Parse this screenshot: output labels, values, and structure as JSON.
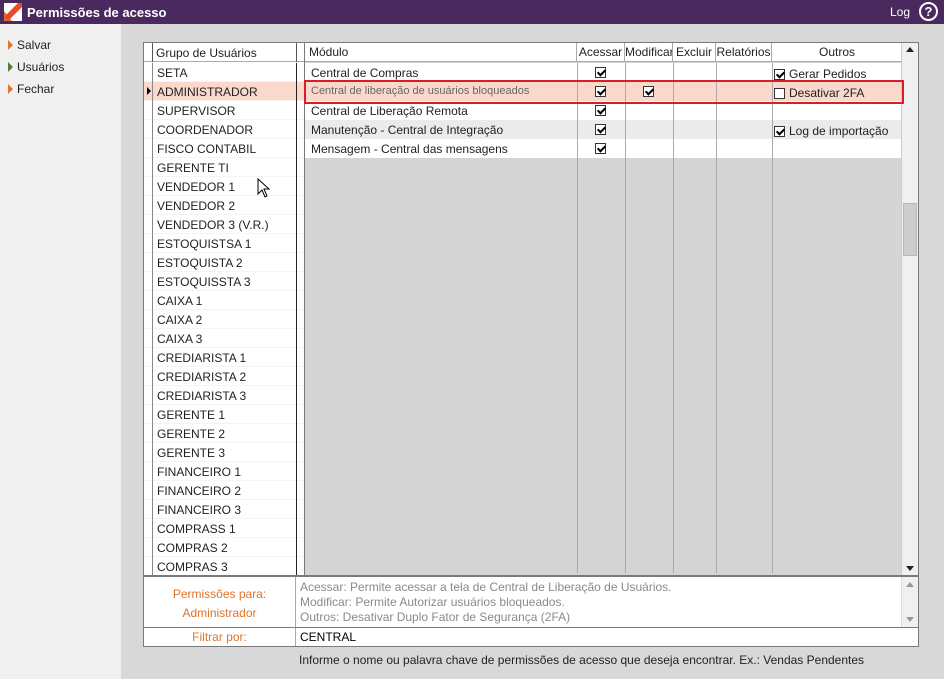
{
  "window": {
    "title": "Permissões de acesso",
    "log_label": "Log",
    "help_label": "?"
  },
  "sidebar": {
    "items": [
      {
        "label": "Salvar",
        "arrow_color": "#e0742a"
      },
      {
        "label": "Usuários",
        "arrow_color": "#5a7a3a"
      },
      {
        "label": "Fechar",
        "arrow_color": "#e0742a"
      }
    ]
  },
  "groups": {
    "header": "Grupo de Usuários",
    "selected_index": 1,
    "items": [
      "SETA",
      "ADMINISTRADOR",
      "SUPERVISOR",
      "COORDENADOR",
      "FISCO CONTABIL",
      "GERENTE TI",
      "VENDEDOR 1",
      "VENDEDOR 2",
      "VENDEDOR 3 (V.R.)",
      "ESTOQUISTSA 1",
      "ESTOQUISTA 2",
      "ESTOQUISSTA 3",
      "CAIXA 1",
      "CAIXA 2",
      "CAIXA 3",
      "CREDIARISTA 1",
      "CREDIARISTA 2",
      "CREDIARISTA 3",
      "GERENTE 1",
      "GERENTE 2",
      "GERENTE 3",
      "FINANCEIRO 1",
      "FINANCEIRO 2",
      "FINANCEIRO 3",
      "COMPRASS 1",
      "COMPRAS 2",
      "COMPRAS 3"
    ]
  },
  "modules": {
    "columns": {
      "modulo": "Módulo",
      "acessar": "Acessar",
      "modificar": "Modificar",
      "excluir": "Excluir",
      "relatorios": "Relatórios",
      "outros": "Outros"
    },
    "selected_index": 1,
    "rows": [
      {
        "name": "Central de Compras",
        "acessar": true,
        "modificar": false,
        "excluir": false,
        "relatorios": false
      },
      {
        "name": "Central de liberação de usuários bloqueados",
        "acessar": true,
        "modificar": true,
        "excluir": false,
        "relatorios": false
      },
      {
        "name": "Central de Liberação Remota",
        "acessar": true,
        "modificar": false,
        "excluir": false,
        "relatorios": false
      },
      {
        "name": "Manutenção - Central de Integração",
        "acessar": true,
        "modificar": false,
        "excluir": false,
        "relatorios": false
      },
      {
        "name": "Mensagem - Central das mensagens",
        "acessar": true,
        "modificar": false,
        "excluir": false,
        "relatorios": false
      }
    ],
    "outros": [
      {
        "label": "Gerar Pedidos",
        "checked": true
      },
      {
        "label": "Desativar 2FA",
        "checked": false
      },
      {
        "label": "Log de importação",
        "checked": true
      }
    ]
  },
  "permissions": {
    "label_line1": "Permissões para:",
    "label_line2": "Administrador",
    "desc_acessar": "Acessar: Permite acessar a tela de Central de Liberação de Usuários.",
    "desc_modificar": "Modificar: Permite Autorizar usuários bloqueados.",
    "desc_outros": "Outros: Desativar Duplo Fator de Segurança (2FA)"
  },
  "filter": {
    "label": "Filtrar por:",
    "value": "CENTRAL"
  },
  "hint": "Informe o nome ou palavra chave de permissões de acesso que deseja encontrar. Ex.: Vendas Pendentes",
  "colors": {
    "titlebar": "#4a2a5e",
    "accent": "#e0742a",
    "highlight": "#d42026",
    "selected_row": "#fbd8cc"
  }
}
